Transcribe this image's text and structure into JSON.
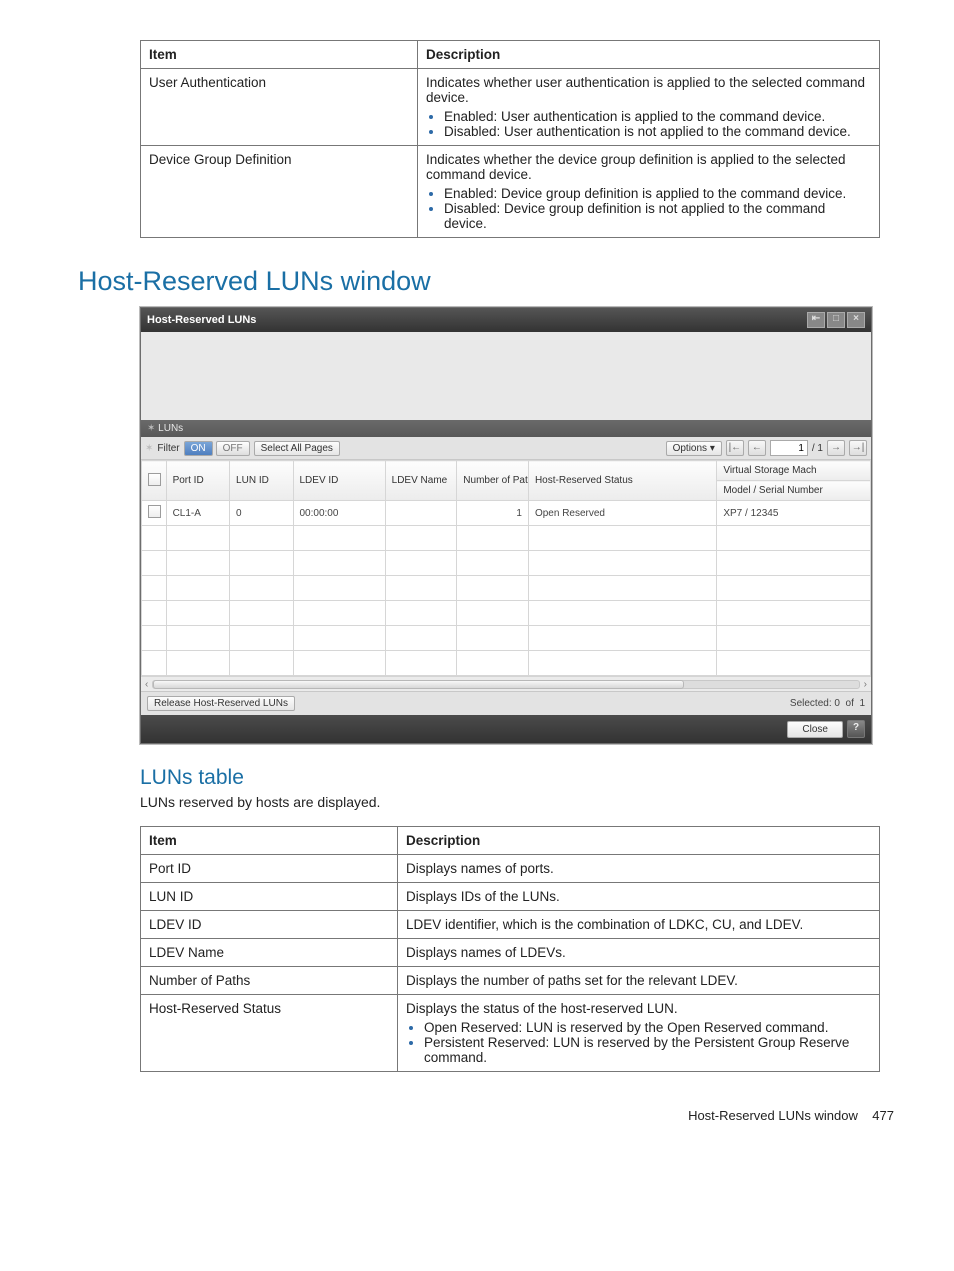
{
  "top_table": {
    "headers": {
      "item": "Item",
      "desc": "Description"
    },
    "rows": [
      {
        "item": "User Authentication",
        "desc": "Indicates whether user authentication is applied to the selected command device.",
        "bullets": [
          "Enabled: User authentication is applied to the command device.",
          "Disabled: User authentication is not applied to the command device."
        ]
      },
      {
        "item": "Device Group Definition",
        "desc": "Indicates whether the device group definition is applied to the selected command device.",
        "bullets": [
          "Enabled: Device group definition is applied to the command device.",
          "Disabled: Device group definition is not applied to the command device."
        ]
      }
    ]
  },
  "section_heading": "Host-Reserved LUNs window",
  "window": {
    "title": "Host-Reserved LUNs",
    "luns_label": "LUNs",
    "filter_label": "Filter",
    "on_label": "ON",
    "off_label": "OFF",
    "select_all_label": "Select All Pages",
    "options_label": "Options",
    "page_current": "1",
    "page_total": "/ 1",
    "columns": {
      "port_id": "Port ID",
      "lun_id": "LUN ID",
      "ldev_id": "LDEV ID",
      "ldev_name": "LDEV Name",
      "num_paths": "Number of Paths",
      "host_reserved": "Host-Reserved Status",
      "vsm_group": "Virtual Storage Mach",
      "vsm_model": "Model / Serial Number"
    },
    "row": {
      "port_id": "CL1-A",
      "lun_id": "0",
      "ldev_id": "00:00:00",
      "ldev_name": "",
      "num_paths": "1",
      "host_reserved": "Open Reserved",
      "vsm_model": "XP7 / 12345"
    },
    "release_btn": "Release Host-Reserved LUNs",
    "selected_label": "Selected:",
    "selected_count": "0",
    "of_label": "of",
    "total_count": "1",
    "close_btn": "Close"
  },
  "subsection_heading": "LUNs table",
  "subsection_intro": "LUNs reserved by hosts are displayed.",
  "luns_table": {
    "headers": {
      "item": "Item",
      "desc": "Description"
    },
    "rows": [
      {
        "item": "Port ID",
        "desc": "Displays names of ports."
      },
      {
        "item": "LUN ID",
        "desc": "Displays IDs of the LUNs."
      },
      {
        "item": "LDEV ID",
        "desc": "LDEV identifier, which is the combination of LDKC, CU, and LDEV."
      },
      {
        "item": "LDEV Name",
        "desc": "Displays names of LDEVs."
      },
      {
        "item": "Number of Paths",
        "desc": "Displays the number of paths set for the relevant LDEV."
      },
      {
        "item": "Host-Reserved Status",
        "desc": "Displays the status of the host-reserved LUN.",
        "bullets": [
          "Open Reserved: LUN is reserved by the Open Reserved command.",
          "Persistent Reserved: LUN is reserved by the Persistent Group Reserve command."
        ]
      }
    ]
  },
  "footer": {
    "text": "Host-Reserved LUNs window",
    "page": "477"
  }
}
